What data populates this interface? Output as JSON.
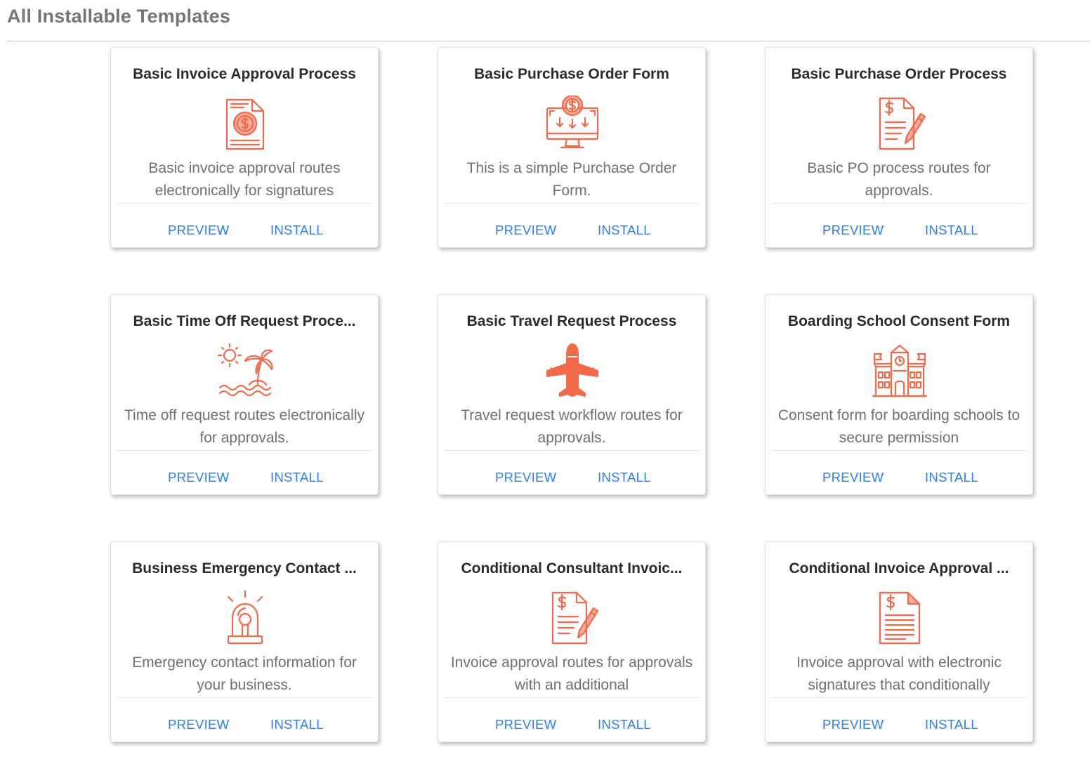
{
  "page": {
    "title": "All Installable Templates"
  },
  "theme": {
    "accent": "#f26a4b",
    "link": "#2f80ed"
  },
  "templates": [
    {
      "title": "Basic Invoice Approval Process",
      "icon": "invoice-dollar-icon",
      "description": "Basic invoice approval routes electronically for signatures",
      "preview_label": "PREVIEW",
      "install_label": "INSTALL"
    },
    {
      "title": "Basic Purchase Order Form",
      "icon": "monitor-dollar-icon",
      "description": "This is a simple Purchase Order Form.",
      "preview_label": "PREVIEW",
      "install_label": "INSTALL"
    },
    {
      "title": "Basic Purchase Order Process",
      "icon": "document-dollar-pen-icon",
      "description": "Basic PO process routes for approvals.",
      "preview_label": "PREVIEW",
      "install_label": "INSTALL"
    },
    {
      "title": "Basic Time Off Request Proce...",
      "icon": "beach-palm-icon",
      "description": "Time off request routes electronically for approvals.",
      "preview_label": "PREVIEW",
      "install_label": "INSTALL"
    },
    {
      "title": "Basic Travel Request Process",
      "icon": "airplane-icon",
      "description": "Travel request workflow routes for approvals.",
      "preview_label": "PREVIEW",
      "install_label": "INSTALL"
    },
    {
      "title": "Boarding School Consent Form",
      "icon": "school-building-icon",
      "description": "Consent form for boarding schools to secure permission",
      "preview_label": "PREVIEW",
      "install_label": "INSTALL"
    },
    {
      "title": "Business Emergency Contact ...",
      "icon": "emergency-siren-icon",
      "description": "Emergency contact information for your business.",
      "preview_label": "PREVIEW",
      "install_label": "INSTALL"
    },
    {
      "title": "Conditional Consultant Invoic...",
      "icon": "document-dollar-pen-icon",
      "description": "Invoice approval routes for approvals with an additional",
      "preview_label": "PREVIEW",
      "install_label": "INSTALL"
    },
    {
      "title": "Conditional Invoice Approval ...",
      "icon": "document-dollar-lines-icon",
      "description": "Invoice approval with electronic signatures that conditionally",
      "preview_label": "PREVIEW",
      "install_label": "INSTALL"
    }
  ]
}
